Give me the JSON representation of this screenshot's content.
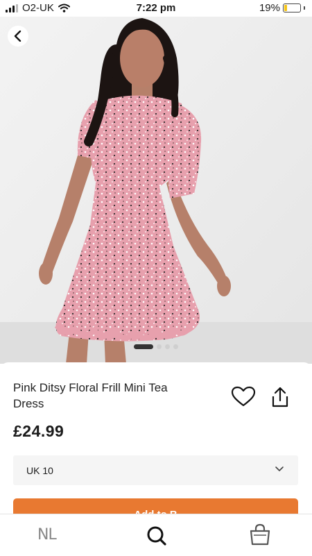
{
  "status_bar": {
    "carrier": "O2-UK",
    "time": "7:22 pm",
    "battery": "19%",
    "battery_level": 0.19
  },
  "gallery": {
    "image_count": 4,
    "active_index": 0
  },
  "product": {
    "title": "Pink Ditsy Floral Frill Mini Tea Dress",
    "price": "£24.99"
  },
  "size_selector": {
    "selected": "UK 10"
  },
  "add_button": {
    "label": "Add to B"
  },
  "bottom_nav": {
    "logo": "NL"
  },
  "colors": {
    "accent": "#e87931",
    "dress_pink": "#e7a0ad"
  }
}
